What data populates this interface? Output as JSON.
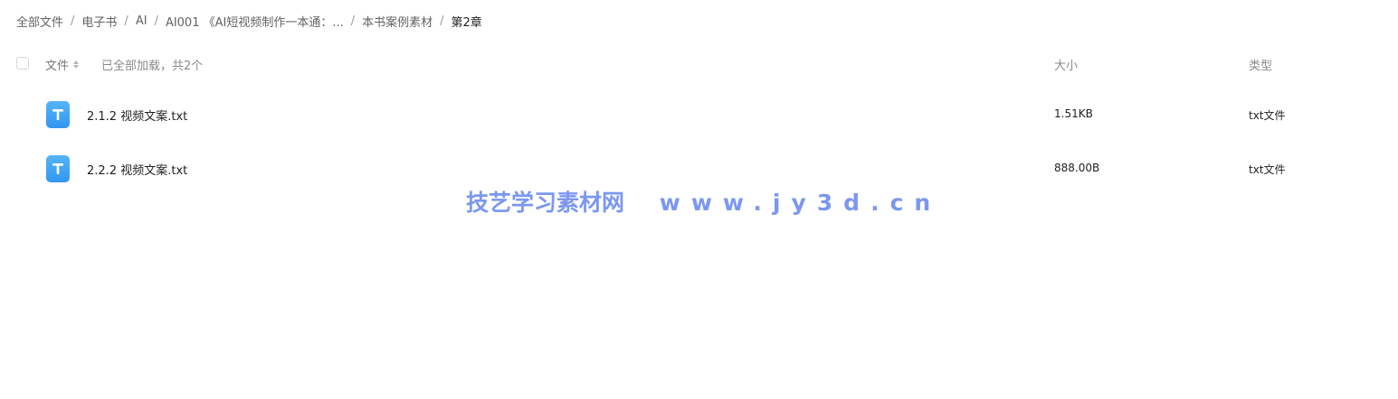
{
  "breadcrumb": {
    "items": [
      "全部文件",
      "电子书",
      "AI",
      "AI001 《AI短视频制作一本通：...",
      "本书案例素材",
      "第2章"
    ],
    "separator": "/"
  },
  "list_header": {
    "file_label": "文件",
    "load_status": "已全部加载，共2个",
    "size_label": "大小",
    "type_label": "类型"
  },
  "files": [
    {
      "name": "2.1.2 视频文案.txt",
      "size": "1.51KB",
      "type": "txt文件",
      "icon": "txt-file-icon"
    },
    {
      "name": "2.2.2 视频文案.txt",
      "size": "888.00B",
      "type": "txt文件",
      "icon": "txt-file-icon"
    }
  ],
  "watermark": {
    "cn": "技艺学习素材网",
    "url": "www.jy3d.cn"
  },
  "colors": {
    "icon_blue": "#3f9ff2",
    "watermark": "#7b97f0"
  }
}
